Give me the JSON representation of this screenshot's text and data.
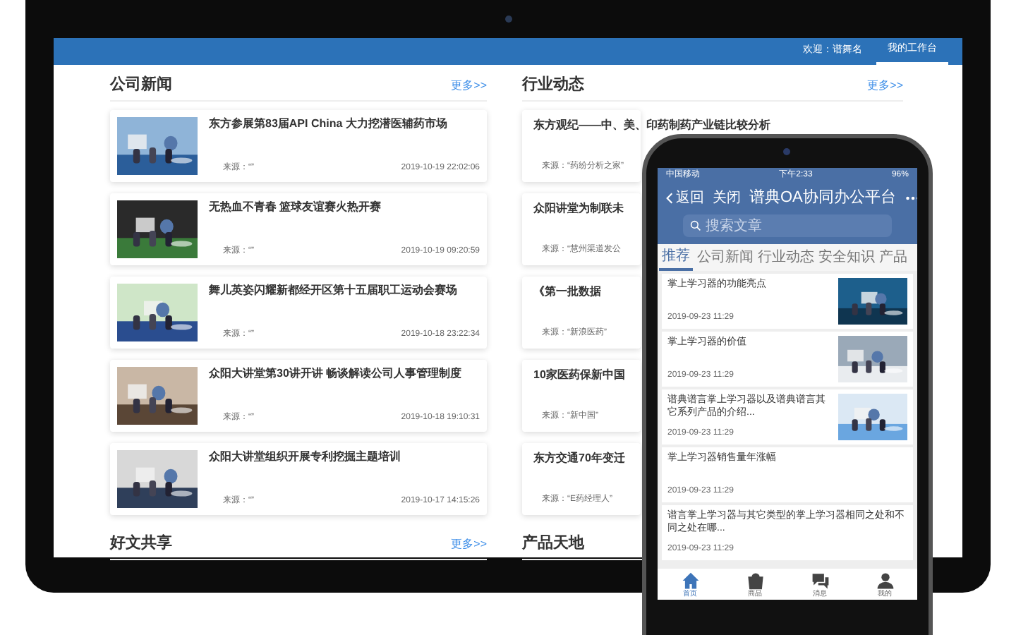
{
  "laptop": {
    "header": {
      "welcome": "欢迎：谱舞名",
      "workbench": "我的工作台"
    },
    "company_news": {
      "title": "公司新闻",
      "more": "更多>>",
      "items": [
        {
          "title": "东方参展第83届API China 大力挖潜医辅药市场",
          "source": "来源：“”",
          "date": "2019-10-19 22:02:06"
        },
        {
          "title": "无热血不青春 篮球友谊赛火热开赛",
          "source": "来源：“”",
          "date": "2019-10-19 09:20:59"
        },
        {
          "title": "舞儿英姿闪耀新都经开区第十五届职工运动会赛场",
          "source": "来源：“”",
          "date": "2019-10-18 23:22:34"
        },
        {
          "title": "众阳大讲堂第30讲开讲 畅谈解读公司人事管理制度",
          "source": "来源：“”",
          "date": "2019-10-18 19:10:31"
        },
        {
          "title": "众阳大讲堂组织开展专利挖掘主题培训",
          "source": "来源：“”",
          "date": "2019-10-17 14:15:26"
        }
      ]
    },
    "good_articles": {
      "title": "好文共享",
      "more": "更多>>"
    },
    "industry_news": {
      "title": "行业动态",
      "more": "更多>>",
      "items": [
        {
          "title": "东方观纪——中、美、印药制药产业链比较分析",
          "source": "来源：“药纷分析之家”"
        },
        {
          "title": "众阳讲堂为制联未",
          "source": "来源：“慧州渠道发公"
        },
        {
          "title": "《第一批数据",
          "source": "来源：“新浪医药”"
        },
        {
          "title": "10家医药保新中国",
          "source": "来源：“新中国”"
        },
        {
          "title": "东方交通70年变迁",
          "source": "来源：“E药经理人”"
        }
      ]
    },
    "products": {
      "title": "产品天地"
    }
  },
  "phone": {
    "status_bar": {
      "carrier": "中国移动",
      "time": "下午2:33",
      "battery": "96%"
    },
    "nav": {
      "back": "返回",
      "close": "关闭",
      "title": "谱典OA协同办公平台"
    },
    "search": {
      "placeholder": "搜索文章"
    },
    "tabs": [
      {
        "label": "推荐",
        "selected": true
      },
      {
        "label": "公司新闻",
        "selected": false
      },
      {
        "label": "行业动态",
        "selected": false
      },
      {
        "label": "安全知识",
        "selected": false
      },
      {
        "label": "产品",
        "selected": false
      }
    ],
    "articles": [
      {
        "kind": "picture",
        "title": "掌上学习器的功能亮点",
        "date": "2019-09-23 11:29"
      },
      {
        "kind": "picture",
        "title": "掌上学习器的价值",
        "date": "2019-09-23 11:29"
      },
      {
        "kind": "picture",
        "title": "谱典谱言掌上学习器以及谱典谱言其它系列产品的介绍...",
        "date": "2019-09-23 11:29"
      },
      {
        "kind": "text",
        "title": "掌上学习器销售量年涨幅",
        "date": "2019-09-23 11:29"
      },
      {
        "kind": "text",
        "title": "谱言掌上学习器与其它类型的掌上学习器相同之处和不同之处在哪...",
        "date": "2019-09-23 11:29"
      }
    ],
    "bottom_nav": [
      {
        "kind": "home",
        "label": "首页",
        "selected": true
      },
      {
        "kind": "bag",
        "label": "商品",
        "selected": false
      },
      {
        "kind": "chat",
        "label": "消息",
        "selected": false
      },
      {
        "kind": "user",
        "label": "我的",
        "selected": false
      }
    ]
  }
}
